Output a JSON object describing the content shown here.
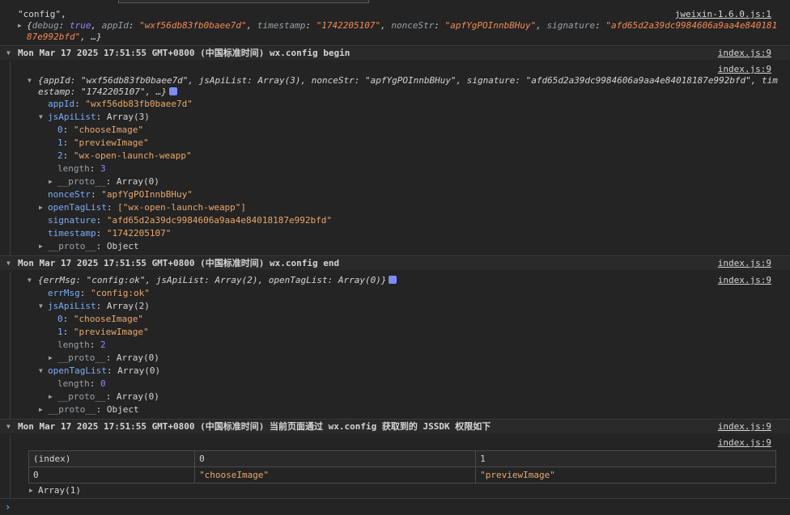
{
  "entry1": {
    "text": "\"config\",",
    "source": "jweixin-1.6.0.js:1",
    "debug_key": "debug",
    "debug_val": "true",
    "appId_key": "appId",
    "appId_val": "\"wxf56db83fb0baee7d\"",
    "timestamp_key": "timestamp",
    "timestamp_val": "\"1742205107\"",
    "nonceStr_key": "nonceStr",
    "nonceStr_val": "\"apfYgPOInnbBHuy\"",
    "signature_key": "signature",
    "signature_val_a": "\"afd65d2a39dc9984606a9aa4e840181",
    "signature_val_b": "87e992bfd\"",
    "rest": ", …}"
  },
  "group1": {
    "title": "Mon Mar 17 2025 17:51:55 GMT+0800 (中国标准时间) wx.config begin",
    "source": "index.js:9",
    "src2": "index.js:9",
    "obj_line1": "{appId: \"wxf56db83fb0baee7d\", jsApiList: Array(3), nonceStr: \"apfYgPOInnbBHuy\", signature: \"afd65d2a39dc9984606a9aa4e84018187e992bfd\", tim",
    "obj_line2": "estamp: \"1742205107\", …}",
    "props": {
      "appId": "appId",
      "appId_val": "\"wxf56db83fb0baee7d\"",
      "jsApiList": "jsApiList",
      "jsApiList_val": "Array(3)",
      "i0": "0",
      "i0_val": "\"chooseImage\"",
      "i1": "1",
      "i1_val": "\"previewImage\"",
      "i2": "2",
      "i2_val": "\"wx-open-launch-weapp\"",
      "length": "length",
      "length_val": "3",
      "proto": "__proto__",
      "proto_arr": "Array(0)",
      "nonceStr": "nonceStr",
      "nonceStr_val": "\"apfYgPOInnbBHuy\"",
      "openTagList": "openTagList",
      "openTagList_val": "[\"wx-open-launch-weapp\"]",
      "signature": "signature",
      "signature_val": "\"afd65d2a39dc9984606a9aa4e84018187e992bfd\"",
      "timestamp": "timestamp",
      "timestamp_val": "\"1742205107\"",
      "proto_obj": "Object"
    }
  },
  "group2": {
    "title": "Mon Mar 17 2025 17:51:55 GMT+0800 (中国标准时间) wx.config end",
    "source": "index.js:9",
    "src2": "index.js:9",
    "obj_line": "{errMsg: \"config:ok\", jsApiList: Array(2), openTagList: Array(0)}",
    "props": {
      "errMsg": "errMsg",
      "errMsg_val": "\"config:ok\"",
      "jsApiList": "jsApiList",
      "jsApiList_val": "Array(2)",
      "i0": "0",
      "i0_val": "\"chooseImage\"",
      "i1": "1",
      "i1_val": "\"previewImage\"",
      "length": "length",
      "length_val": "2",
      "proto": "__proto__",
      "proto_arr": "Array(0)",
      "openTagList": "openTagList",
      "openTagList_val": "Array(0)",
      "length0": "length",
      "length0_val": "0",
      "proto_obj": "Object"
    }
  },
  "group3": {
    "title": "Mon Mar 17 2025 17:51:55 GMT+0800 (中国标准时间) 当前页面通过 wx.config 获取到的 JSSDK 权限如下",
    "source": "index.js:9",
    "src2": "index.js:9",
    "table": {
      "headers": [
        "(index)",
        "0",
        "1"
      ],
      "rows": [
        [
          "0",
          "\"chooseImage\"",
          "\"previewImage\""
        ]
      ]
    },
    "array_label": "Array(1)"
  },
  "prompt": "›"
}
